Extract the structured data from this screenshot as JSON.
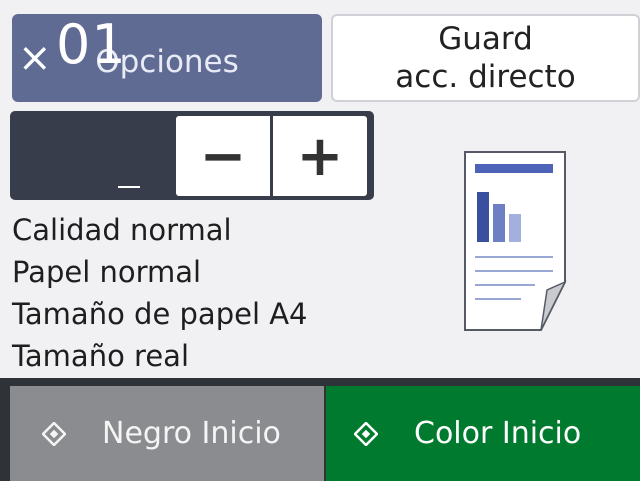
{
  "buttons": {
    "options_label": "Opciones",
    "shortcut_line1": "Guard",
    "shortcut_line2": "acc. directo",
    "black_start_label": "Negro Inicio",
    "color_start_label": "Color Inicio"
  },
  "copies": {
    "prefix": "×",
    "value": "01",
    "minus_label": "−",
    "plus_label": "+"
  },
  "settings": [
    "Calidad normal",
    "Papel normal",
    "Tamaño de papel A4",
    "Tamaño real"
  ],
  "icons": {
    "start": "diamond-start-icon",
    "preview": "document-preview-icon"
  },
  "colors": {
    "options_button": "#5f6b93",
    "color_start_button": "#007a2e",
    "black_start_button": "#8b8c8f",
    "copies_box": "#373d4a"
  }
}
